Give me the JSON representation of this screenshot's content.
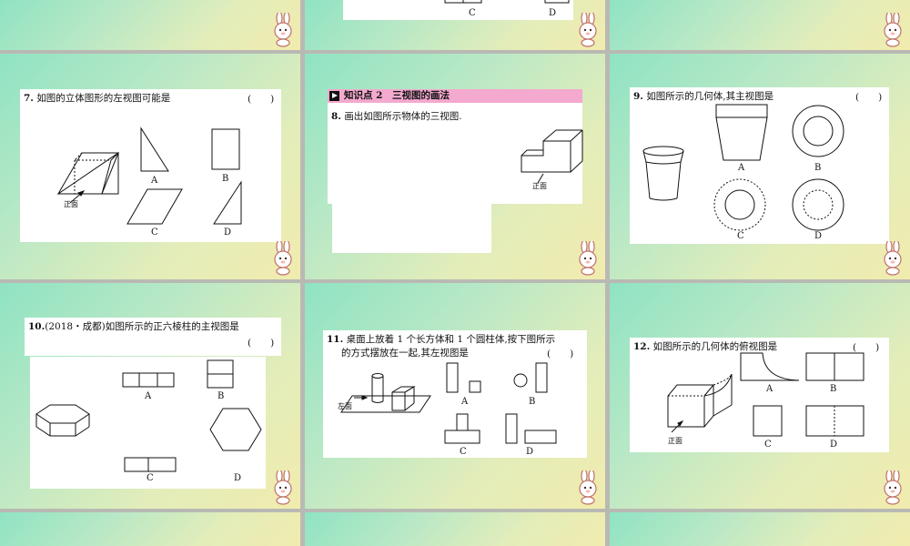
{
  "slides": {
    "q7": {
      "num": "7.",
      "text": "如图的立体图形的左视图可能是",
      "paren": "(　　)",
      "options": [
        "A",
        "B",
        "C",
        "D"
      ],
      "front_label": "正面"
    },
    "q8": {
      "section": "知识点 2　三视图的画法",
      "num": "8.",
      "text": "画出如图所示物体的三视图.",
      "front_label": "正面"
    },
    "q9": {
      "num": "9.",
      "text": "如图所示的几何体,其主视图是",
      "paren": "(　　)",
      "options": [
        "A",
        "B",
        "C",
        "D"
      ]
    },
    "q10": {
      "num": "10.",
      "text": "(2018・成都)如图所示的正六棱柱的主视图是",
      "paren": "(　　)",
      "options": [
        "A",
        "B",
        "C",
        "D"
      ]
    },
    "q11": {
      "num": "11.",
      "line1": "桌面上放着 1 个长方体和 1 个圆柱体,按下图所示",
      "line2": "的方式摆放在一起,其左视图是",
      "paren": "(　　)",
      "options": [
        "A",
        "B",
        "C",
        "D"
      ],
      "left_label": "左面"
    },
    "q12": {
      "num": "12.",
      "text": "如图所示的几何体的俯视图是",
      "paren": "(　　)",
      "options": [
        "A",
        "B",
        "C",
        "D"
      ],
      "front_label": "正面"
    },
    "top_row": {
      "options": [
        "C",
        "D"
      ]
    }
  }
}
